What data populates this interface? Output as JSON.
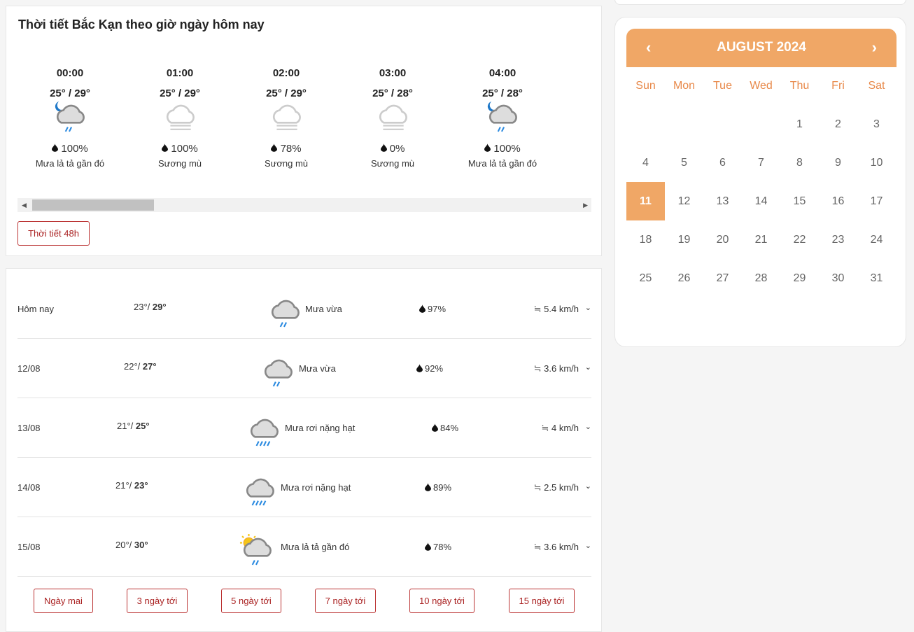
{
  "hourly": {
    "title": "Thời tiết Bắc Kạn theo giờ ngày hôm nay",
    "button": "Thời tiết 48h",
    "items": [
      {
        "time": "00:00",
        "temp": "25° / 29°",
        "icon": "moon-cloud-rain-icon",
        "pct": "100%",
        "desc": "Mưa lả tả gần đó"
      },
      {
        "time": "01:00",
        "temp": "25° / 29°",
        "icon": "fog-icon",
        "pct": "100%",
        "desc": "Sương mù"
      },
      {
        "time": "02:00",
        "temp": "25° / 29°",
        "icon": "fog-icon",
        "pct": "78%",
        "desc": "Sương mù"
      },
      {
        "time": "03:00",
        "temp": "25° / 28°",
        "icon": "fog-icon",
        "pct": "0%",
        "desc": "Sương mù"
      },
      {
        "time": "04:00",
        "temp": "25° / 28°",
        "icon": "moon-cloud-rain-icon",
        "pct": "100%",
        "desc": "Mưa lả tả gần đó"
      }
    ]
  },
  "daily": {
    "rows": [
      {
        "day": "Hôm nay",
        "min": "23°",
        "max": "29°",
        "icon": "cloud-rain-icon",
        "desc": "Mưa vừa",
        "pct": "97%",
        "wind": "5.4 km/h"
      },
      {
        "day": "12/08",
        "min": "22°",
        "max": "27°",
        "icon": "cloud-rain-icon",
        "desc": "Mưa vừa",
        "pct": "92%",
        "wind": "3.6 km/h"
      },
      {
        "day": "13/08",
        "min": "21°",
        "max": "25°",
        "icon": "cloud-heavy-rain-icon",
        "desc": "Mưa rơi nặng hạt",
        "pct": "84%",
        "wind": "4 km/h"
      },
      {
        "day": "14/08",
        "min": "21°",
        "max": "23°",
        "icon": "cloud-heavy-rain-icon",
        "desc": "Mưa rơi nặng hạt",
        "pct": "89%",
        "wind": "2.5 km/h"
      },
      {
        "day": "15/08",
        "min": "20°",
        "max": "30°",
        "icon": "sun-cloud-rain-icon",
        "desc": "Mưa lả tả gần đó",
        "pct": "78%",
        "wind": "3.6 km/h"
      }
    ],
    "buttons": [
      "Ngày mai",
      "3 ngày tới",
      "5 ngày tới",
      "7 ngày tới",
      "10 ngày tới",
      "15 ngày tới"
    ]
  },
  "calendar": {
    "month": "AUGUST 2024",
    "prev": "‹",
    "next": "›",
    "weekdays": [
      "Sun",
      "Mon",
      "Tue",
      "Wed",
      "Thu",
      "Fri",
      "Sat"
    ],
    "first_weekday": 4,
    "days": 31,
    "selected": 11,
    "accent": "#f0a766"
  }
}
